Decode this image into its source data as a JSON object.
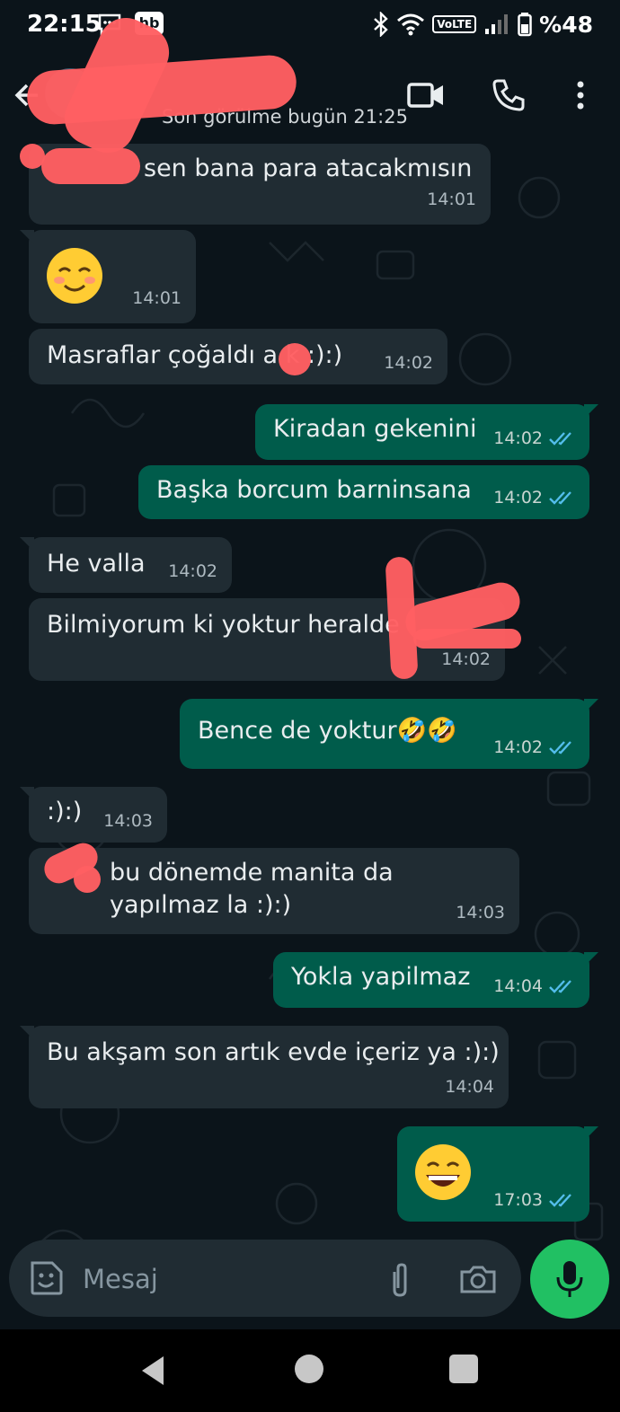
{
  "status_bar": {
    "time": "22:15",
    "badge": "hb",
    "network": "VoLTE",
    "battery": "%48"
  },
  "header": {
    "contact_name": "",
    "last_seen": "Son görülme bugün 21:25",
    "icons": [
      "back-arrow-icon",
      "video-call-icon",
      "voice-call-icon",
      "more-vert-icon"
    ]
  },
  "messages": [
    {
      "dir": "in",
      "text": "sen bana para atacakmısın",
      "time": "14:01"
    },
    {
      "dir": "in",
      "text": "☺️",
      "time": "14:01"
    },
    {
      "dir": "in",
      "text": "Masraflar çoğaldı a   k :):)",
      "time": "14:02"
    },
    {
      "dir": "out",
      "text": "Kiradan gekenini",
      "time": "14:02",
      "read": true
    },
    {
      "dir": "out",
      "text": "Başka borcum barninsana",
      "time": "14:02",
      "read": true
    },
    {
      "dir": "in",
      "text": "He valla",
      "time": "14:02"
    },
    {
      "dir": "in",
      "text": "Bilmiyorum ki yoktur heralde",
      "time": "14:02"
    },
    {
      "dir": "out",
      "text": "Bence de yoktur🤣🤣",
      "time": "14:02",
      "read": true
    },
    {
      "dir": "in",
      "text": ":):)",
      "time": "14:03"
    },
    {
      "dir": "in",
      "text": "bu dönemde manita da yapılmaz la :):)",
      "time": "14:03"
    },
    {
      "dir": "out",
      "text": "Yokla yapilmaz",
      "time": "14:04",
      "read": true
    },
    {
      "dir": "in",
      "text": "Bu akşam son artık evde içeriz ya :):)",
      "time": "14:04"
    },
    {
      "dir": "out",
      "text": "😄",
      "time": "17:03",
      "read": true
    }
  ],
  "composer": {
    "placeholder": "Mesaj",
    "icons": [
      "sticker-icon",
      "attach-icon",
      "camera-icon",
      "mic-icon"
    ]
  },
  "colors": {
    "background": "#0b141a",
    "incoming_bubble": "#202c33",
    "outgoing_bubble": "#005c4b",
    "mic_button": "#21c063",
    "read_ticks": "#53bdeb",
    "redaction": "#ff5f62"
  }
}
